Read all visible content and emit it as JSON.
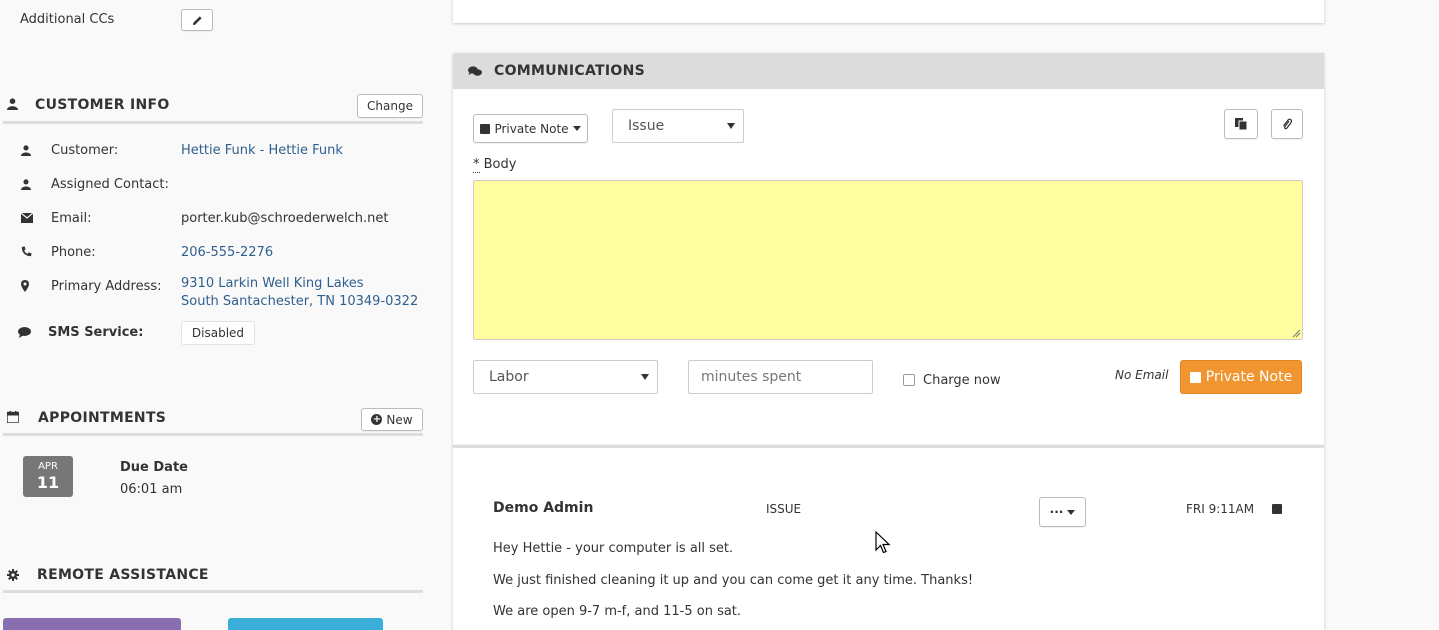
{
  "left": {
    "additional_ccs": {
      "label": "Additional CCs",
      "edit_icon": "pencil-icon"
    },
    "customer_info": {
      "title": "CUSTOMER INFO",
      "change_label": "Change",
      "rows": {
        "customer": {
          "label": "Customer:",
          "value": "Hettie Funk - Hettie Funk",
          "icon": "user-icon"
        },
        "contact": {
          "label": "Assigned Contact:",
          "value": "",
          "icon": "user-icon"
        },
        "email": {
          "label": "Email:",
          "value": "porter.kub@schroederwelch.net",
          "icon": "envelope-icon"
        },
        "phone": {
          "label": "Phone:",
          "value": "206-555-2276",
          "icon": "phone-icon"
        },
        "address": {
          "label": "Primary Address:",
          "line1": "9310 Larkin Well King Lakes",
          "line2": "South Santachester, TN 10349-0322",
          "icon": "map-marker-icon"
        },
        "sms": {
          "label": "SMS Service:",
          "value": "Disabled",
          "icon": "comment-icon"
        }
      }
    },
    "appointments": {
      "title": "APPOINTMENTS",
      "new_label": "New",
      "item": {
        "month": "APR",
        "day": "11",
        "title": "Due Date",
        "time": "06:01 am"
      }
    },
    "remote_assistance": {
      "title": "REMOTE ASSISTANCE"
    }
  },
  "communications": {
    "title": "COMMUNICATIONS",
    "type_button": "Private Note",
    "category_select": "Issue",
    "body_label": "Body",
    "body_required": "*",
    "body_value": "",
    "labor_select": "Labor",
    "minutes_placeholder": "minutes spent",
    "charge_now": "Charge now",
    "no_email": "No Email",
    "submit_label": "Private Note"
  },
  "message": {
    "author": "Demo Admin",
    "category": "ISSUE",
    "actions_label": "···",
    "time": "FRI 9:11AM",
    "lines": [
      "Hey Hettie - your computer is all set.",
      "We just finished cleaning it up and you can come get it any time. Thanks!",
      "We are open 9-7 m-f, and 11-5 on sat."
    ]
  },
  "colors": {
    "accent_orange": "#f0952f",
    "body_yellow": "#ffff9f",
    "link_blue": "#31608f",
    "header_gray": "#dcdcdc"
  }
}
